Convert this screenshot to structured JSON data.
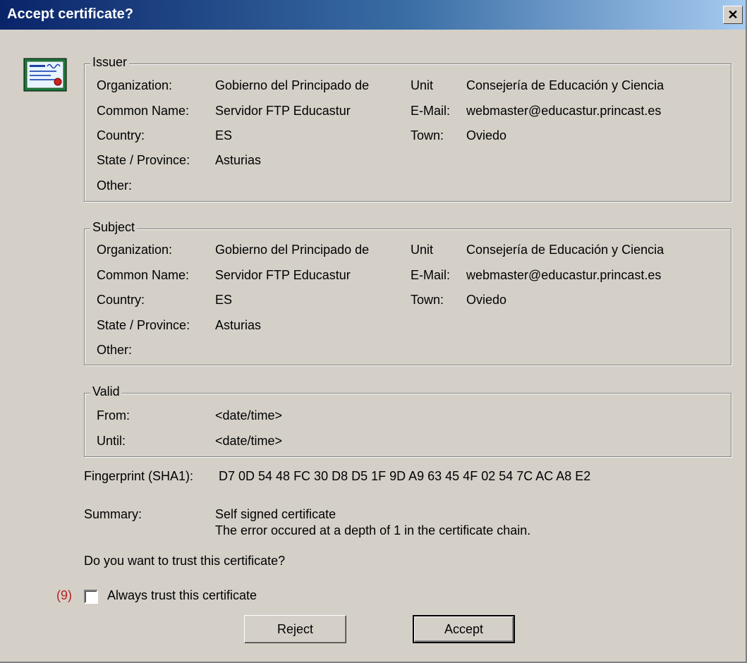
{
  "window": {
    "title": "Accept certificate?",
    "close_label": "x"
  },
  "issuer": {
    "legend": "Issuer",
    "organization_label": "Organization:",
    "organization": "Gobierno del Principado de",
    "unit_label": "Unit",
    "unit": "Consejería de Educación y Ciencia",
    "common_name_label": "Common Name:",
    "common_name": "Servidor FTP Educastur",
    "email_label": "E-Mail:",
    "email": "webmaster@educastur.princast.es",
    "country_label": "Country:",
    "country": "ES",
    "town_label": "Town:",
    "town": "Oviedo",
    "state_label": "State / Province:",
    "state": "Asturias",
    "other_label": "Other:"
  },
  "subject": {
    "legend": "Subject",
    "organization_label": "Organization:",
    "organization": "Gobierno del Principado de",
    "unit_label": "Unit",
    "unit": "Consejería de Educación y Ciencia",
    "common_name_label": "Common Name:",
    "common_name": "Servidor FTP Educastur",
    "email_label": "E-Mail:",
    "email": "webmaster@educastur.princast.es",
    "country_label": "Country:",
    "country": "ES",
    "town_label": "Town:",
    "town": "Oviedo",
    "state_label": "State / Province:",
    "state": "Asturias",
    "other_label": "Other:"
  },
  "valid": {
    "legend": "Valid",
    "from_label": "From:",
    "from": "<date/time>",
    "until_label": "Until:",
    "until": "<date/time>"
  },
  "fingerprint": {
    "label": "Fingerprint (SHA1):",
    "value": "D7 0D 54 48 FC 30 D8 D5 1F 9D A9 63 45 4F 02 54 7C AC A8 E2"
  },
  "summary": {
    "label": "Summary:",
    "line1": "Self signed certificate",
    "line2": "The error occured at a depth of 1 in the certificate chain."
  },
  "question": "Do you want to trust this certificate?",
  "always_trust": {
    "marker": "(9)",
    "label": "Always trust this certificate",
    "checked": false
  },
  "buttons": {
    "reject": "Reject",
    "accept": "Accept"
  },
  "colors": {
    "title_start": "#0a246a",
    "title_end": "#a6caf0",
    "face": "#d4d0c8",
    "marker": "#b22222"
  }
}
